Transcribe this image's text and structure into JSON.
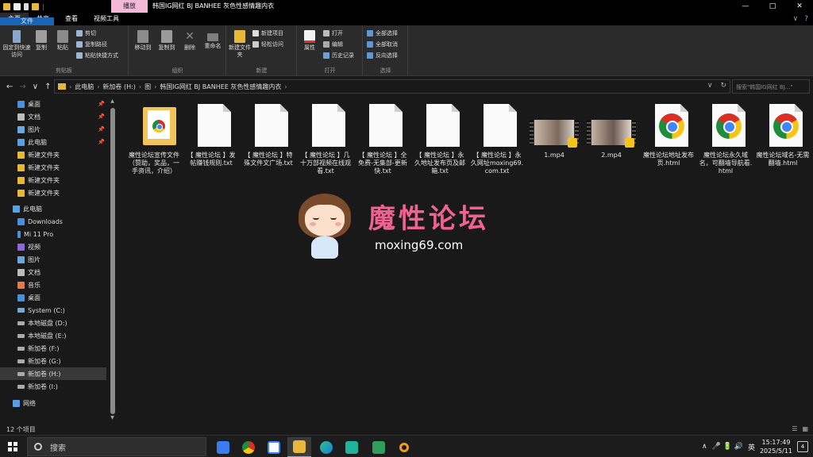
{
  "titlebar": {
    "context_tab": "播放",
    "title": "韩国IG网红 BJ BANHEE 灰色性感情趣内衣",
    "qat_sep": "|",
    "ctrl_min": "—",
    "ctrl_max": "□",
    "ctrl_close": "✕"
  },
  "tabs": {
    "file": "文件",
    "home": "主页",
    "share": "共享",
    "view": "查看",
    "tools": "视频工具",
    "expand": "∨",
    "help": "?"
  },
  "ribbon": {
    "clipboard": {
      "label": "剪贴板",
      "pin": "固定到快速访问",
      "copy": "复制",
      "paste": "粘贴",
      "cut": "剪切",
      "copy_path": "复制路径",
      "paste_shortcut": "粘贴快捷方式"
    },
    "organize": {
      "label": "组织",
      "move_to": "移动到",
      "copy_to": "复制到",
      "delete": "删除",
      "rename": "重命名"
    },
    "new": {
      "label": "新建",
      "new_folder": "新建文件夹",
      "new_item": "新建项目",
      "easy_access": "轻松访问"
    },
    "open": {
      "label": "打开",
      "properties": "属性",
      "open": "打开",
      "edit": "编辑",
      "history": "历史记录"
    },
    "select": {
      "label": "选择",
      "select_all": "全部选择",
      "select_none": "全部取消",
      "invert": "反向选择"
    }
  },
  "addressbar": {
    "back": "←",
    "forward": "→",
    "recent": "∨",
    "up": "↑",
    "crumbs": [
      "此电脑",
      "新加卷 (H:)",
      "图",
      "韩国IG网红 BJ BANHEE 灰色性感情趣内衣"
    ],
    "crumb_sep": "›",
    "dropdown": "∨",
    "refresh": "↻",
    "search_placeholder": "搜索\"韩国IG网红 BJ...\""
  },
  "sidebar": {
    "items": [
      {
        "label": "桌面",
        "pinned": "📌"
      },
      {
        "label": "文档",
        "pinned": "📌"
      },
      {
        "label": "图片",
        "pinned": "📌"
      },
      {
        "label": "此电脑",
        "pinned": "📌"
      },
      {
        "label": "新建文件夹"
      },
      {
        "label": "新建文件夹"
      },
      {
        "label": "新建文件夹"
      },
      {
        "label": "新建文件夹"
      },
      {
        "label": "此电脑"
      },
      {
        "label": "Downloads"
      },
      {
        "label": "Mi 11 Pro"
      },
      {
        "label": "视频"
      },
      {
        "label": "图片"
      },
      {
        "label": "文档"
      },
      {
        "label": "音乐"
      },
      {
        "label": "桌面"
      },
      {
        "label": "System (C:)"
      },
      {
        "label": "本地磁盘 (D:)"
      },
      {
        "label": "本地磁盘 (E:)"
      },
      {
        "label": "新加卷 (F:)"
      },
      {
        "label": "新加卷 (G:)"
      },
      {
        "label": "新加卷 (H:)"
      },
      {
        "label": "新加卷 (I:)"
      },
      {
        "label": "网络"
      }
    ]
  },
  "files": [
    {
      "name": "魔性论坛宣传文件（赞助，奖品，一手资讯，介绍）",
      "type": "folder"
    },
    {
      "name": "【 魔性论坛 】发帖赚钱规则.txt",
      "type": "txt"
    },
    {
      "name": "【 魔性论坛 】特殊文件文广场.txt",
      "type": "txt"
    },
    {
      "name": "【 魔性论坛 】几十万部视频在线观看.txt",
      "type": "txt"
    },
    {
      "name": "【 魔性论坛 】全免费-无集部-更新快.txt",
      "type": "txt"
    },
    {
      "name": "【 魔性论坛 】永久地址发布页及邮箱.txt",
      "type": "txt"
    },
    {
      "name": "【 魔性论坛 】永久网址moxing69.com.txt",
      "type": "txt"
    },
    {
      "name": "1.mp4",
      "type": "video"
    },
    {
      "name": "2.mp4",
      "type": "video"
    },
    {
      "name": "魔性论坛地址发布页.html",
      "type": "html"
    },
    {
      "name": "魔性论坛永久域名，可翻墙导航看.html",
      "type": "html"
    },
    {
      "name": "魔性论坛域名-无需翻墙.html",
      "type": "html"
    }
  ],
  "watermark": {
    "brand": "魔性论坛",
    "site": "moxing69.com"
  },
  "statusbar": {
    "count": "12 个项目",
    "view_details": "☰",
    "view_icons": "▦"
  },
  "taskbar": {
    "search": "搜索",
    "tray_chevron": "∧",
    "tray_icons": "🎤 🔋 🔊",
    "lang": "英",
    "time": "15:17:49",
    "date": "2025/5/11",
    "notif": "4"
  },
  "colors": {
    "accent": "#1b63b5",
    "context_tab": "#f4b8d8",
    "brand": "#f06292",
    "folder": "#e8b83a"
  }
}
